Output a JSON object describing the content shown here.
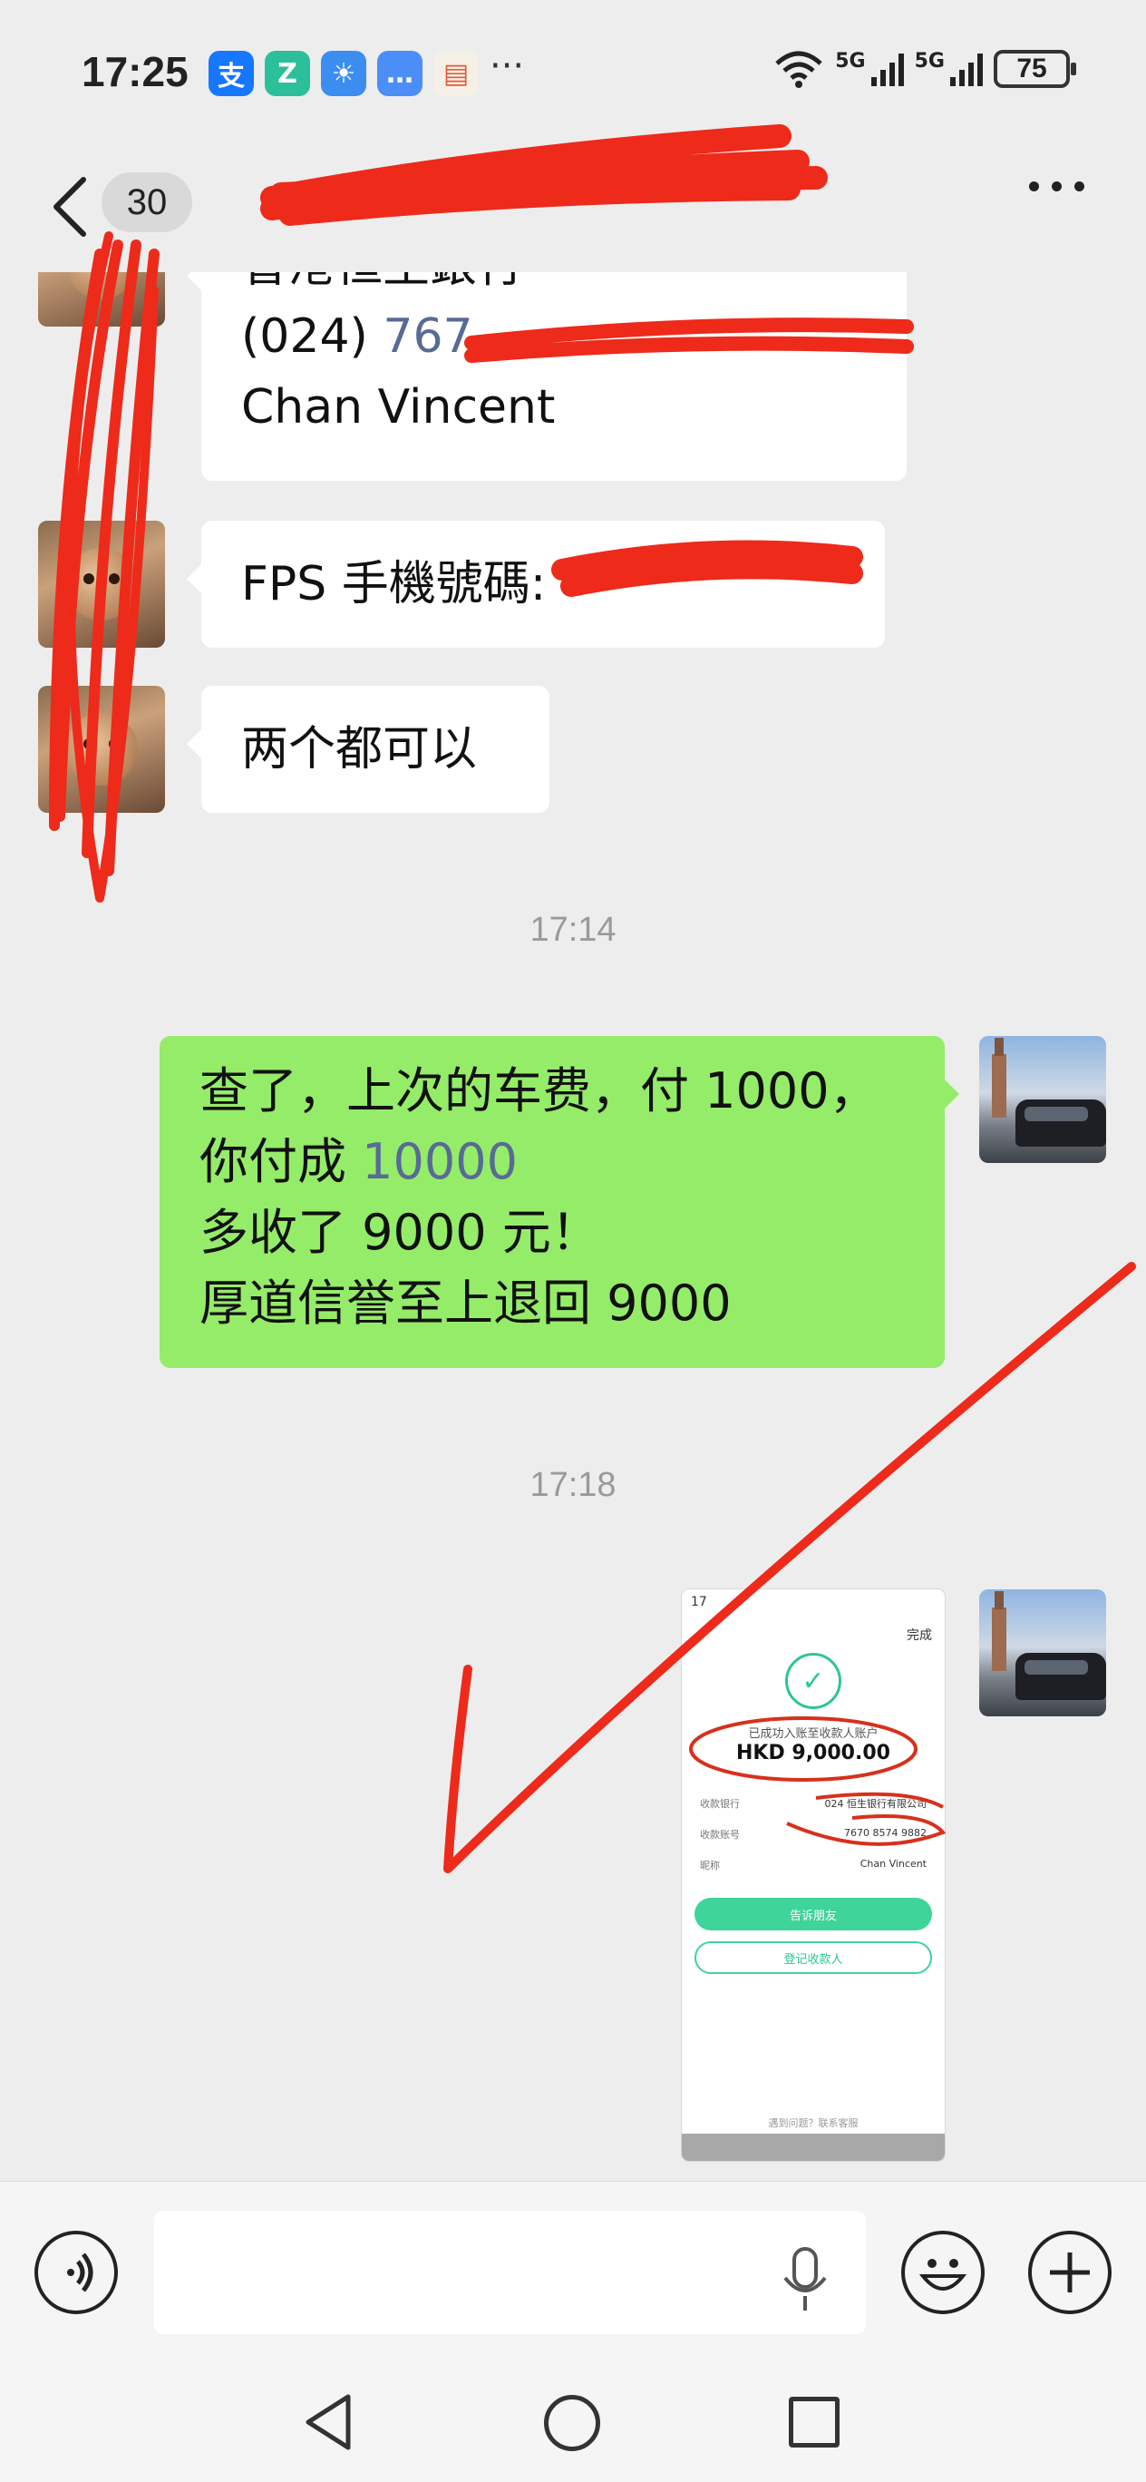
{
  "status_bar": {
    "time": "17:25",
    "apps": [
      {
        "name": "alipay-icon",
        "glyph": "支",
        "color": "#1677ff"
      },
      {
        "name": "zhihu-icon",
        "glyph": "Z",
        "color": "#2bbf9a"
      },
      {
        "name": "weather-icon",
        "glyph": "☀",
        "color": "#3b8ef0"
      },
      {
        "name": "message-icon",
        "glyph": "…",
        "color": "#4c8ef7"
      },
      {
        "name": "wallet-icon",
        "glyph": "▤",
        "color": "#f5f0e6"
      }
    ],
    "more": "···",
    "net_label_1": "5G",
    "net_label_2": "5G",
    "battery": "75"
  },
  "header": {
    "unread_count": "30"
  },
  "messages": {
    "m1_line1": "香港恒生銀行",
    "m1_line2_prefix": "(024)",
    "m1_line2_link": "767",
    "m1_line3": "Chan Vincent",
    "m2_prefix": "FPS 手機號碼:",
    "m3": "两个都可以",
    "time_1": "17:14",
    "m4_line1": "查了，上次的车费，付 1000，",
    "m4_line2_prefix": "你付成 ",
    "m4_line2_link": "10000",
    "m4_line3": "多收了 9000 元！",
    "m4_line4": "厚道信誉至上退回 9000",
    "time_2": "17:18"
  },
  "screenshot_msg": {
    "status": "17",
    "done": "完成",
    "caption": "已成功入账至收款人账户",
    "amount": "HKD 9,000.00",
    "rows": [
      {
        "label": "收款银行",
        "value": "024 恒生银行有限公司"
      },
      {
        "label": "收款账号",
        "value": "7670 8574 9882"
      },
      {
        "label": "昵称",
        "value": "Chan Vincent"
      }
    ],
    "btn_primary": "告诉朋友",
    "btn_secondary": "登记收款人",
    "footer": "遇到问题？联系客服"
  },
  "colors": {
    "bg": "#ededed",
    "incoming_bubble": "#ffffff",
    "outgoing_bubble": "#95ec69",
    "link": "#576b95",
    "marker": "#ee2a1b"
  }
}
